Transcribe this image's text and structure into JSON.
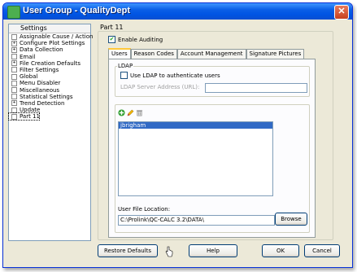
{
  "window": {
    "title": "User Group - QualityDept",
    "close_glyph": "✕"
  },
  "tree": {
    "header": "Settings",
    "items": [
      {
        "label": "Assignable Cause / Action",
        "box": ""
      },
      {
        "label": "Configure Plot Settings",
        "box": "+"
      },
      {
        "label": "Data Collection",
        "box": "+"
      },
      {
        "label": "Email",
        "box": ""
      },
      {
        "label": "File Creation Defaults",
        "box": "+"
      },
      {
        "label": "Filter Settings",
        "box": ""
      },
      {
        "label": "Global",
        "box": ""
      },
      {
        "label": "Menu Disabler",
        "box": ""
      },
      {
        "label": "Miscellaneous",
        "box": ""
      },
      {
        "label": "Statistical Settings",
        "box": ""
      },
      {
        "label": "Trend Detection",
        "box": "+"
      },
      {
        "label": "Update",
        "box": ""
      },
      {
        "label": "Part 11",
        "box": ""
      }
    ]
  },
  "panel": {
    "group_title": "Part 11",
    "enable_auditing": {
      "label": "Enable Auditing",
      "checked": "✔"
    },
    "tabs": [
      "Users",
      "Reason Codes",
      "Account Management",
      "Signature Pictures"
    ],
    "ldap": {
      "legend": "LDAP",
      "use_ldap_label": "Use LDAP to authenticate users",
      "server_label": "LDAP Server Address (URL):",
      "server_value": ""
    },
    "users": [
      "jbrigham"
    ],
    "file_location_label": "User File Location:",
    "file_location_value": "C:\\Prolink\\QC-CALC 3.2\\DATA\\",
    "browse_label": "Browse"
  },
  "footer": {
    "restore_label": "Restore Defaults",
    "help_label": "Help",
    "ok_label": "OK",
    "cancel_label": "Cancel"
  },
  "colors": {
    "title_bar": "#0054e3",
    "selection": "#316ac5",
    "add_icon": "#2e9e2e"
  }
}
